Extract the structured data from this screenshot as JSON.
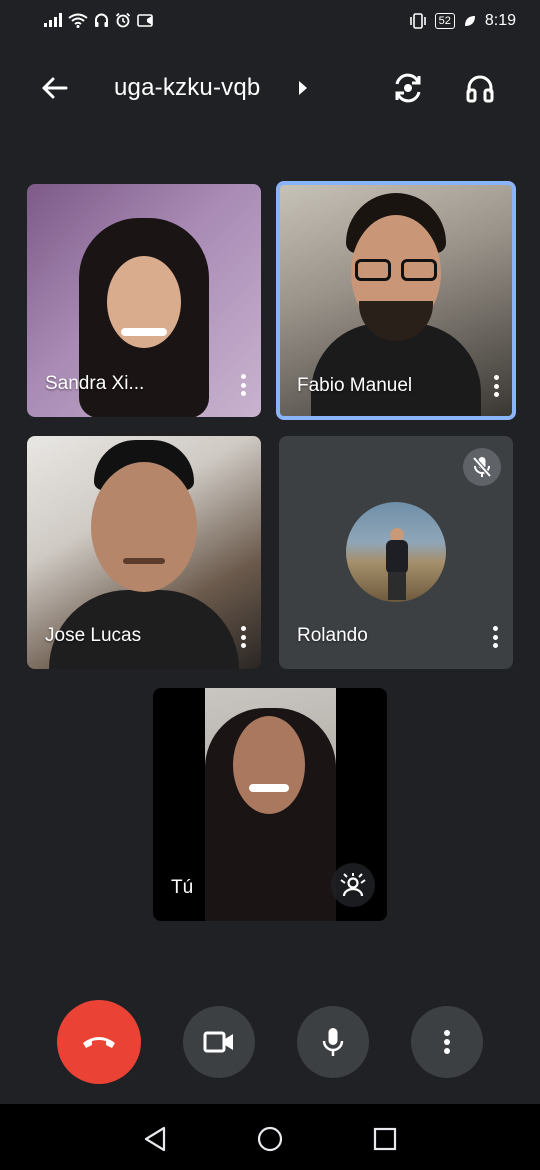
{
  "status_bar": {
    "time": "8:19",
    "battery": "52",
    "left_icons": [
      "signal-icon",
      "wifi-icon",
      "headset-icon",
      "alarm-icon",
      "cast-icon"
    ],
    "right_icons": [
      "vibrate-icon",
      "battery-icon",
      "leaf-icon"
    ]
  },
  "header": {
    "meeting_code": "uga-kzku-vqb",
    "icons": [
      "back-arrow-icon",
      "caret-right-icon",
      "switch-camera-icon",
      "headphones-icon"
    ]
  },
  "participants": [
    {
      "name": "Sandra Xi...",
      "active_speaker": false,
      "muted": false,
      "video_on": true
    },
    {
      "name": "Fabio Manuel",
      "active_speaker": true,
      "muted": false,
      "video_on": true
    },
    {
      "name": "Jose Lucas",
      "active_speaker": false,
      "muted": false,
      "video_on": true
    },
    {
      "name": "Rolando",
      "active_speaker": false,
      "muted": true,
      "video_on": false
    }
  ],
  "self_tile": {
    "name": "Tú"
  },
  "controls": [
    "end-call-icon",
    "camera-icon",
    "microphone-icon",
    "more-vert-icon"
  ],
  "nav": [
    "back-triangle-icon",
    "home-circle-icon",
    "recents-square-icon"
  ],
  "colors": {
    "background": "#202124",
    "tile": "#3c4043",
    "active_border": "#8ab4f8",
    "end_call": "#ea4335"
  }
}
